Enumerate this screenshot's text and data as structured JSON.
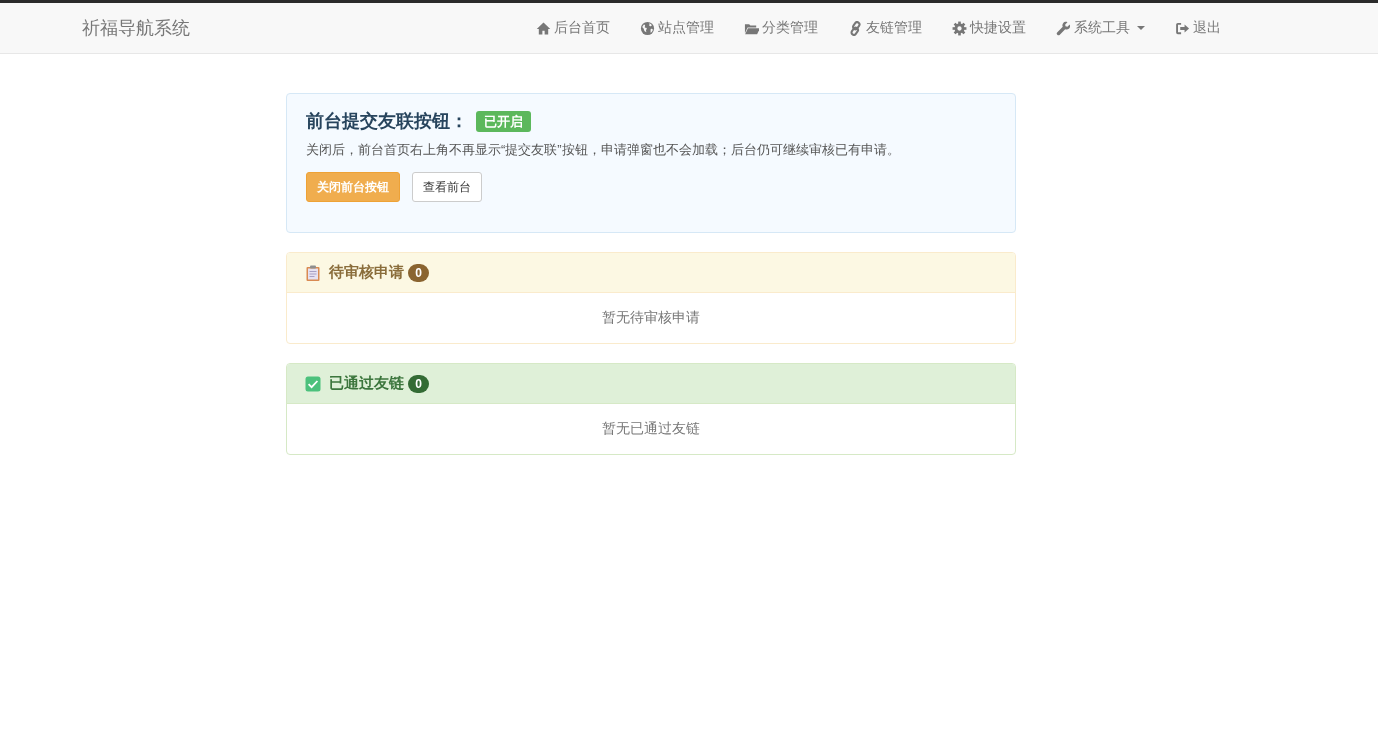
{
  "navbar": {
    "brand": "祈福导航系统",
    "items": [
      {
        "label": "后台首页",
        "dropdown": false
      },
      {
        "label": "站点管理",
        "dropdown": false
      },
      {
        "label": "分类管理",
        "dropdown": false
      },
      {
        "label": "友链管理",
        "dropdown": false
      },
      {
        "label": "快捷设置",
        "dropdown": false
      },
      {
        "label": "系统工具",
        "dropdown": true
      },
      {
        "label": "退出",
        "dropdown": false
      }
    ]
  },
  "setting": {
    "title": "前台提交友联按钮：",
    "status": {
      "label": "已开启",
      "on": true
    },
    "description": "关闭后，前台首页右上角不再显示“提交友联”按钮，申请弹窗也不会加载；后台仍可继续审核已有申请。",
    "buttons": [
      {
        "label": "关闭前台按钮",
        "kind": "warning"
      },
      {
        "label": "查看前台",
        "kind": "default"
      }
    ]
  },
  "sections": [
    {
      "kind": "pending",
      "title": "待审核申请",
      "count": "0",
      "empty_text": "暂无待审核申请"
    },
    {
      "kind": "approved",
      "title": "已通过友链",
      "count": "0",
      "empty_text": "暂无已通过友链"
    }
  ]
}
